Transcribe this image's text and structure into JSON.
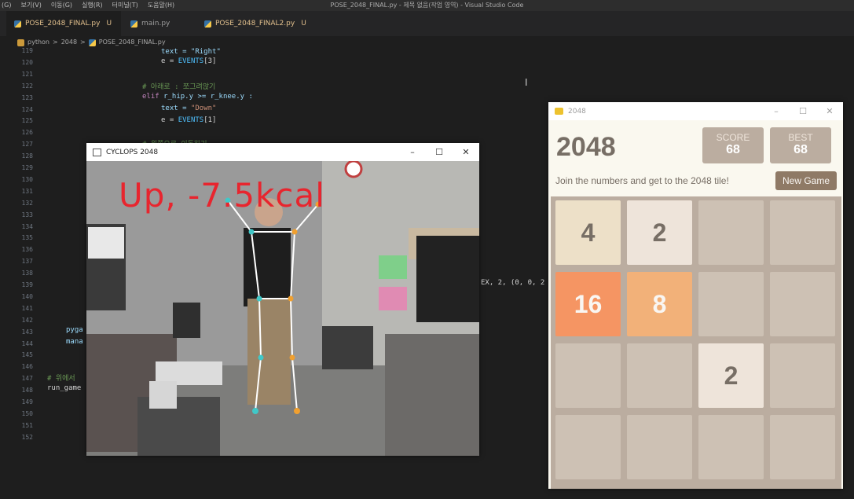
{
  "menubar": {
    "items": [
      "(G)",
      "보기(V)",
      "이동(G)",
      "실행(R)",
      "터미널(T)",
      "도움말(H)"
    ],
    "window_title": "POSE_2048_FINAL.py - 제목 없음(작업 영역) - Visual Studio Code"
  },
  "tabs": [
    {
      "label": "POSE_2048_FINAL.py",
      "status": "U"
    },
    {
      "label": "main.py",
      "status": ""
    },
    {
      "label": "POSE_2048_FINAL2.py",
      "status": "U"
    }
  ],
  "breadcrumb": [
    "python",
    "2048",
    "POSE_2048_FINAL.py"
  ],
  "breadcrumb_sep": ">",
  "line_numbers": [
    "119",
    "120",
    "121",
    "122",
    "123",
    "124",
    "125",
    "126",
    "127",
    "128",
    "129",
    "130",
    "131",
    "132",
    "133",
    "134",
    "135",
    "136",
    "137",
    "138",
    "139",
    "140",
    "141",
    "142",
    "143",
    "144",
    "145",
    "146",
    "147",
    "148",
    "149",
    "150",
    "151",
    "152"
  ],
  "code": {
    "l119": "text = \"Right\"",
    "l120_a": "e = ",
    "l120_b": "EVENTS",
    "l120_c": "[3]",
    "l122": "# 아래로 : 쪼그려앉기",
    "l123_a": "elif ",
    "l123_b": "r_hip.y >= r_knee.y :",
    "l124_a": "text = ",
    "l124_b": "\"Down\"",
    "l125_a": "e = ",
    "l125_b": "EVENTS",
    "l125_c": "[1]",
    "l127": "# 왼쪽으로 이동하기",
    "l139": "EX, 2, (0, 0, 2",
    "l143": "pyga",
    "l144": "mana",
    "l147": "# 위에서",
    "l148": "run_game"
  },
  "camera_window": {
    "title": "CYCLOPS 2048",
    "caption": "Up, -7.5kcal",
    "controls": [
      "–",
      "☐",
      "✕"
    ]
  },
  "game_window": {
    "title": "2048",
    "controls": [
      "–",
      "☐",
      "✕"
    ],
    "heading": "2048",
    "score_label": "SCORE",
    "score_value": "68",
    "best_label": "BEST",
    "best_value": "68",
    "intro": "Join the numbers and get to the 2048 tile!",
    "new_game": "New Game",
    "grid": [
      [
        "4",
        "2",
        "",
        ""
      ],
      [
        "16",
        "8",
        "",
        ""
      ],
      [
        "",
        "",
        "2",
        ""
      ],
      [
        "",
        "",
        "",
        ""
      ]
    ]
  },
  "colors": {
    "tile_2": "#eee4da",
    "tile_4": "#ede0c8",
    "tile_8": "#f2b179",
    "tile_16": "#f59563",
    "caption": "#e8252e"
  },
  "icons": [
    "python-file-icon",
    "folder-icon",
    "app-icon",
    "minimize-icon",
    "maximize-icon",
    "close-icon",
    "text-cursor-icon"
  ]
}
